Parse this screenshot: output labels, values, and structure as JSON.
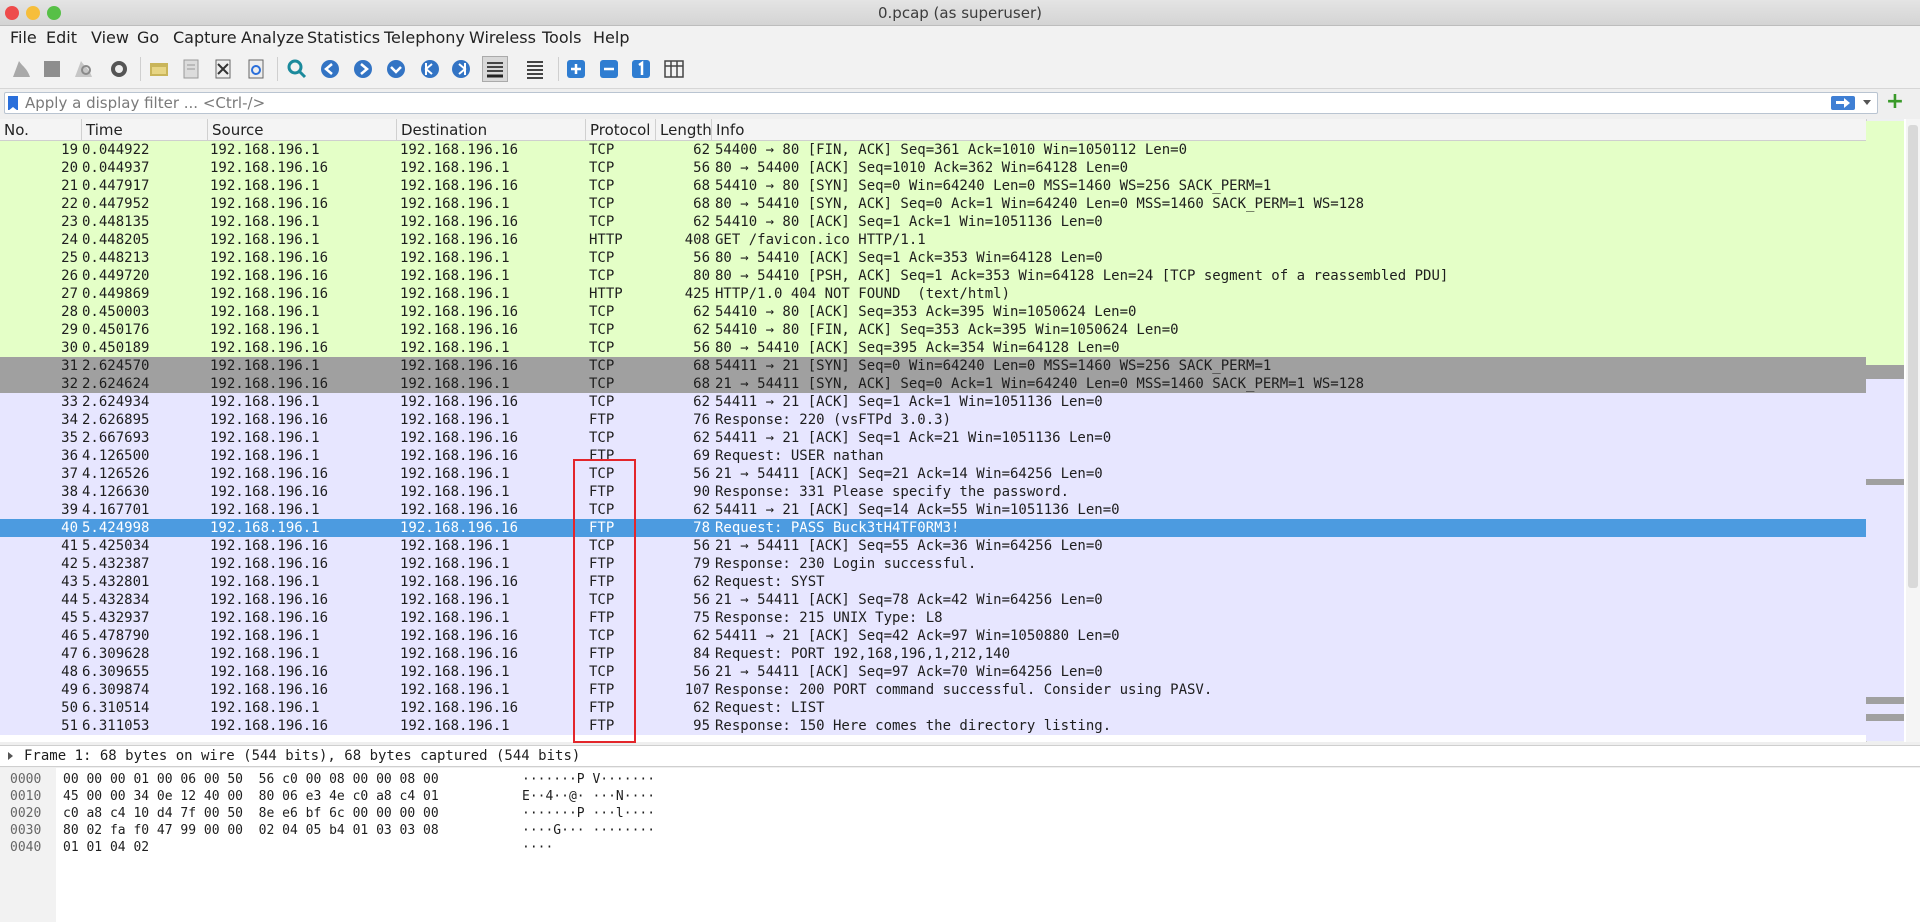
{
  "window": {
    "title": "0.pcap (as superuser)"
  },
  "menu": [
    "File",
    "Edit",
    "View",
    "Go",
    "Capture",
    "Analyze",
    "Statistics",
    "Telephony",
    "Wireless",
    "Tools",
    "Help"
  ],
  "filter": {
    "placeholder": "Apply a display filter ... <Ctrl-/>"
  },
  "columns": [
    "No.",
    "Time",
    "Source",
    "Destination",
    "Protocol",
    "Length",
    "Info"
  ],
  "colors": {
    "http_tcp": "#e4ffc7",
    "tcp_syn": "#a0a0a0",
    "ftp": "#e7e6ff",
    "selected": "#4c9be0"
  },
  "rows": [
    {
      "no": "19",
      "time": "0.044922",
      "src": "192.168.196.1",
      "dst": "192.168.196.16",
      "proto": "TCP",
      "len": "62",
      "info": "54400 → 80 [FIN, ACK] Seq=361 Ack=1010 Win=1050112 Len=0",
      "style": "green"
    },
    {
      "no": "20",
      "time": "0.044937",
      "src": "192.168.196.16",
      "dst": "192.168.196.1",
      "proto": "TCP",
      "len": "56",
      "info": "80 → 54400 [ACK] Seq=1010 Ack=362 Win=64128 Len=0",
      "style": "green"
    },
    {
      "no": "21",
      "time": "0.447917",
      "src": "192.168.196.1",
      "dst": "192.168.196.16",
      "proto": "TCP",
      "len": "68",
      "info": "54410 → 80 [SYN] Seq=0 Win=64240 Len=0 MSS=1460 WS=256 SACK_PERM=1",
      "style": "green"
    },
    {
      "no": "22",
      "time": "0.447952",
      "src": "192.168.196.16",
      "dst": "192.168.196.1",
      "proto": "TCP",
      "len": "68",
      "info": "80 → 54410 [SYN, ACK] Seq=0 Ack=1 Win=64240 Len=0 MSS=1460 SACK_PERM=1 WS=128",
      "style": "green"
    },
    {
      "no": "23",
      "time": "0.448135",
      "src": "192.168.196.1",
      "dst": "192.168.196.16",
      "proto": "TCP",
      "len": "62",
      "info": "54410 → 80 [ACK] Seq=1 Ack=1 Win=1051136 Len=0",
      "style": "green"
    },
    {
      "no": "24",
      "time": "0.448205",
      "src": "192.168.196.1",
      "dst": "192.168.196.16",
      "proto": "HTTP",
      "len": "408",
      "info": "GET /favicon.ico HTTP/1.1",
      "style": "green"
    },
    {
      "no": "25",
      "time": "0.448213",
      "src": "192.168.196.16",
      "dst": "192.168.196.1",
      "proto": "TCP",
      "len": "56",
      "info": "80 → 54410 [ACK] Seq=1 Ack=353 Win=64128 Len=0",
      "style": "green"
    },
    {
      "no": "26",
      "time": "0.449720",
      "src": "192.168.196.16",
      "dst": "192.168.196.1",
      "proto": "TCP",
      "len": "80",
      "info": "80 → 54410 [PSH, ACK] Seq=1 Ack=353 Win=64128 Len=24 [TCP segment of a reassembled PDU]",
      "style": "green"
    },
    {
      "no": "27",
      "time": "0.449869",
      "src": "192.168.196.16",
      "dst": "192.168.196.1",
      "proto": "HTTP",
      "len": "425",
      "info": "HTTP/1.0 404 NOT FOUND  (text/html)",
      "style": "green"
    },
    {
      "no": "28",
      "time": "0.450003",
      "src": "192.168.196.1",
      "dst": "192.168.196.16",
      "proto": "TCP",
      "len": "62",
      "info": "54410 → 80 [ACK] Seq=353 Ack=395 Win=1050624 Len=0",
      "style": "green"
    },
    {
      "no": "29",
      "time": "0.450176",
      "src": "192.168.196.1",
      "dst": "192.168.196.16",
      "proto": "TCP",
      "len": "62",
      "info": "54410 → 80 [FIN, ACK] Seq=353 Ack=395 Win=1050624 Len=0",
      "style": "green"
    },
    {
      "no": "30",
      "time": "0.450189",
      "src": "192.168.196.16",
      "dst": "192.168.196.1",
      "proto": "TCP",
      "len": "56",
      "info": "80 → 54410 [ACK] Seq=395 Ack=354 Win=64128 Len=0",
      "style": "green"
    },
    {
      "no": "31",
      "time": "2.624570",
      "src": "192.168.196.1",
      "dst": "192.168.196.16",
      "proto": "TCP",
      "len": "68",
      "info": "54411 → 21 [SYN] Seq=0 Win=64240 Len=0 MSS=1460 WS=256 SACK_PERM=1",
      "style": "gray"
    },
    {
      "no": "32",
      "time": "2.624624",
      "src": "192.168.196.16",
      "dst": "192.168.196.1",
      "proto": "TCP",
      "len": "68",
      "info": "21 → 54411 [SYN, ACK] Seq=0 Ack=1 Win=64240 Len=0 MSS=1460 SACK_PERM=1 WS=128",
      "style": "gray"
    },
    {
      "no": "33",
      "time": "2.624934",
      "src": "192.168.196.1",
      "dst": "192.168.196.16",
      "proto": "TCP",
      "len": "62",
      "info": "54411 → 21 [ACK] Seq=1 Ack=1 Win=1051136 Len=0",
      "style": "purple"
    },
    {
      "no": "34",
      "time": "2.626895",
      "src": "192.168.196.16",
      "dst": "192.168.196.1",
      "proto": "FTP",
      "len": "76",
      "info": "Response: 220 (vsFTPd 3.0.3)",
      "style": "purple"
    },
    {
      "no": "35",
      "time": "2.667693",
      "src": "192.168.196.1",
      "dst": "192.168.196.16",
      "proto": "TCP",
      "len": "62",
      "info": "54411 → 21 [ACK] Seq=1 Ack=21 Win=1051136 Len=0",
      "style": "purple"
    },
    {
      "no": "36",
      "time": "4.126500",
      "src": "192.168.196.1",
      "dst": "192.168.196.16",
      "proto": "FTP",
      "len": "69",
      "info": "Request: USER nathan",
      "style": "purple"
    },
    {
      "no": "37",
      "time": "4.126526",
      "src": "192.168.196.16",
      "dst": "192.168.196.1",
      "proto": "TCP",
      "len": "56",
      "info": "21 → 54411 [ACK] Seq=21 Ack=14 Win=64256 Len=0",
      "style": "purple"
    },
    {
      "no": "38",
      "time": "4.126630",
      "src": "192.168.196.16",
      "dst": "192.168.196.1",
      "proto": "FTP",
      "len": "90",
      "info": "Response: 331 Please specify the password.",
      "style": "purple"
    },
    {
      "no": "39",
      "time": "4.167701",
      "src": "192.168.196.1",
      "dst": "192.168.196.16",
      "proto": "TCP",
      "len": "62",
      "info": "54411 → 21 [ACK] Seq=14 Ack=55 Win=1051136 Len=0",
      "style": "purple"
    },
    {
      "no": "40",
      "time": "5.424998",
      "src": "192.168.196.1",
      "dst": "192.168.196.16",
      "proto": "FTP",
      "len": "78",
      "info": "Request: PASS Buck3tH4TF0RM3!",
      "style": "selected"
    },
    {
      "no": "41",
      "time": "5.425034",
      "src": "192.168.196.16",
      "dst": "192.168.196.1",
      "proto": "TCP",
      "len": "56",
      "info": "21 → 54411 [ACK] Seq=55 Ack=36 Win=64256 Len=0",
      "style": "purple"
    },
    {
      "no": "42",
      "time": "5.432387",
      "src": "192.168.196.16",
      "dst": "192.168.196.1",
      "proto": "FTP",
      "len": "79",
      "info": "Response: 230 Login successful.",
      "style": "purple"
    },
    {
      "no": "43",
      "time": "5.432801",
      "src": "192.168.196.1",
      "dst": "192.168.196.16",
      "proto": "FTP",
      "len": "62",
      "info": "Request: SYST",
      "style": "purple"
    },
    {
      "no": "44",
      "time": "5.432834",
      "src": "192.168.196.16",
      "dst": "192.168.196.1",
      "proto": "TCP",
      "len": "56",
      "info": "21 → 54411 [ACK] Seq=78 Ack=42 Win=64256 Len=0",
      "style": "purple"
    },
    {
      "no": "45",
      "time": "5.432937",
      "src": "192.168.196.16",
      "dst": "192.168.196.1",
      "proto": "FTP",
      "len": "75",
      "info": "Response: 215 UNIX Type: L8",
      "style": "purple"
    },
    {
      "no": "46",
      "time": "5.478790",
      "src": "192.168.196.1",
      "dst": "192.168.196.16",
      "proto": "TCP",
      "len": "62",
      "info": "54411 → 21 [ACK] Seq=42 Ack=97 Win=1050880 Len=0",
      "style": "purple"
    },
    {
      "no": "47",
      "time": "6.309628",
      "src": "192.168.196.1",
      "dst": "192.168.196.16",
      "proto": "FTP",
      "len": "84",
      "info": "Request: PORT 192,168,196,1,212,140",
      "style": "purple"
    },
    {
      "no": "48",
      "time": "6.309655",
      "src": "192.168.196.16",
      "dst": "192.168.196.1",
      "proto": "TCP",
      "len": "56",
      "info": "21 → 54411 [ACK] Seq=97 Ack=70 Win=64256 Len=0",
      "style": "purple"
    },
    {
      "no": "49",
      "time": "6.309874",
      "src": "192.168.196.16",
      "dst": "192.168.196.1",
      "proto": "FTP",
      "len": "107",
      "info": "Response: 200 PORT command successful. Consider using PASV.",
      "style": "purple"
    },
    {
      "no": "50",
      "time": "6.310514",
      "src": "192.168.196.1",
      "dst": "192.168.196.16",
      "proto": "FTP",
      "len": "62",
      "info": "Request: LIST",
      "style": "purple"
    },
    {
      "no": "51",
      "time": "6.311053",
      "src": "192.168.196.16",
      "dst": "192.168.196.1",
      "proto": "FTP",
      "len": "95",
      "info": "Response: 150 Here comes the directory listing.",
      "style": "purple"
    }
  ],
  "details": {
    "frame_summary": "Frame 1: 68 bytes on wire (544 bits), 68 bytes captured (544 bits)"
  },
  "bytes": [
    {
      "off": "0000",
      "hex": "00 00 00 01 00 06 00 50  56 c0 00 08 00 00 08 00",
      "ascii": "·······P V·······"
    },
    {
      "off": "0010",
      "hex": "45 00 00 34 0e 12 40 00  80 06 e3 4e c0 a8 c4 01",
      "ascii": "E··4··@· ···N····"
    },
    {
      "off": "0020",
      "hex": "c0 a8 c4 10 d4 7f 00 50  8e e6 bf 6c 00 00 00 00",
      "ascii": "·······P ···l····"
    },
    {
      "off": "0030",
      "hex": "80 02 fa f0 47 99 00 00  02 04 05 b4 01 03 03 08",
      "ascii": "····G··· ········"
    },
    {
      "off": "0040",
      "hex": "01 01 04 02",
      "ascii": "····"
    }
  ]
}
